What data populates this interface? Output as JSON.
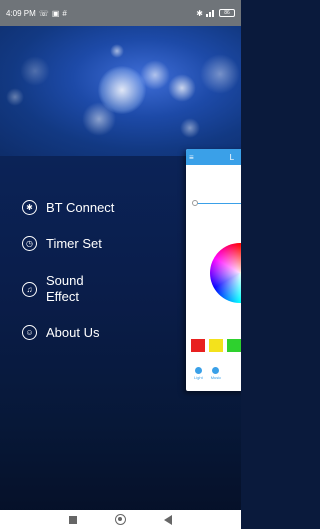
{
  "status_bar": {
    "time": "4:09 PM",
    "battery": "86"
  },
  "menu": {
    "items": [
      {
        "label": "BT Connect",
        "icon": "bluetooth-icon"
      },
      {
        "label": "Timer Set",
        "icon": "timer-icon"
      },
      {
        "label_line1": "Sound",
        "label_line2": "Effect",
        "icon": "sound-wave-icon"
      },
      {
        "label": "About Us",
        "icon": "user-icon"
      }
    ]
  },
  "preview": {
    "title": "L",
    "swatches": [
      "#e82020",
      "#f3e21c",
      "#2ed12e"
    ],
    "tabs": [
      "Light",
      "Music"
    ]
  },
  "colors": {
    "accent": "#3aa0e8",
    "background": "#0b2357"
  }
}
